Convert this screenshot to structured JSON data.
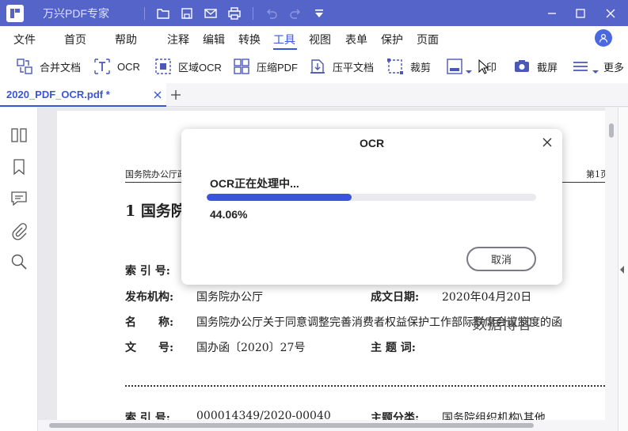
{
  "app": {
    "title": "万兴PDF专家"
  },
  "menu": {
    "items": [
      "文件",
      "首页",
      "帮助",
      "注释",
      "编辑",
      "转换",
      "工具",
      "视图",
      "表单",
      "保护",
      "页面"
    ],
    "active": "工具"
  },
  "tools": {
    "merge": "合并文档",
    "ocr": "OCR",
    "area_ocr": "区域OCR",
    "compress": "压缩PDF",
    "flatten": "压平文档",
    "crop": "裁剪",
    "print": "印",
    "screenshot": "截屏",
    "more": "更多"
  },
  "tab": {
    "label": "2020_PDF_OCR.pdf *"
  },
  "document": {
    "header_left": "国务院办公厅政",
    "header_right": "第1页",
    "heading": "1  国务院",
    "fields": {
      "index_label": "索 引 号:",
      "publisher_label": "发布机构:",
      "publisher_value": "国务院办公厅",
      "date_label": "成文日期:",
      "date_value": "2020年04月20日",
      "name_label": "名　　称:",
      "name_value": "国务院办公厅关于同意调整完善消费者权益保护工作部际联席会议制度的函",
      "docno_label": "文　　号:",
      "docno_value": "国办函〔2020〕27号",
      "subject_label": "主 题 词:",
      "index2_label": "索 引 号:",
      "index2_value": "000014349/2020-00040",
      "category_label": "主题分类:",
      "category_value": "国务院组织机构\\其他"
    },
    "watermark": "数据博客"
  },
  "dialog": {
    "title": "OCR",
    "status": "OCR正在处理中...",
    "progress": 0.4406,
    "percent_text": "44.06%",
    "cancel_label": "取消"
  },
  "colors": {
    "titlebar": "#5564c9",
    "accent": "#3b55d9"
  }
}
